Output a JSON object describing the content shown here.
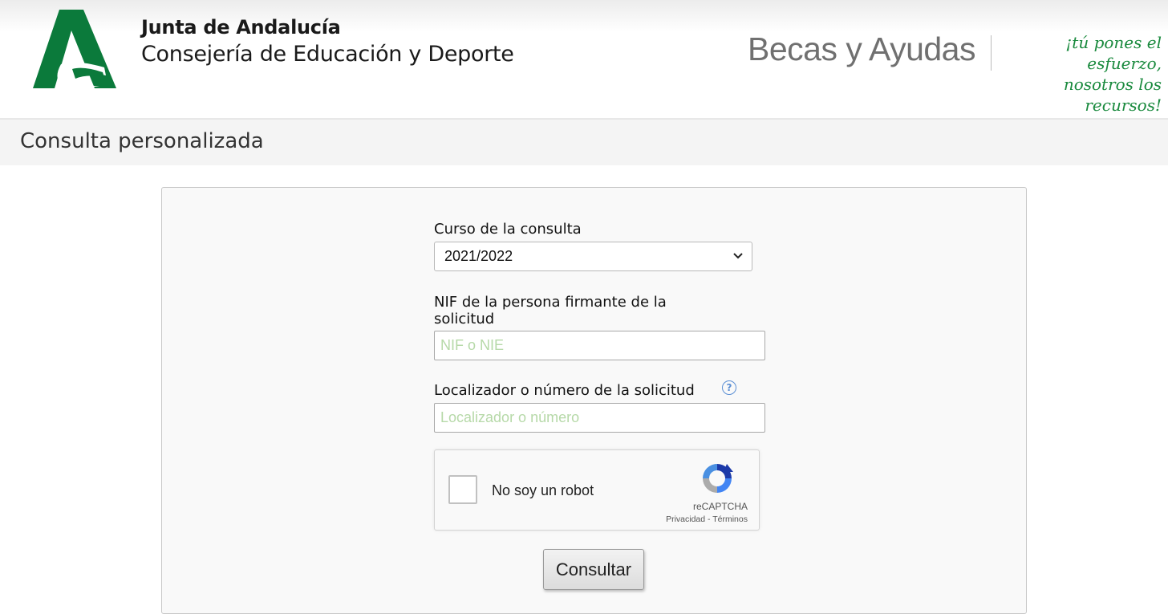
{
  "header": {
    "org_name": "Junta de Andalucía",
    "dept_name": "Consejería de Educación y Deporte",
    "program_title": "Becas y Ayudas",
    "slogan_line1": "¡tú pones el esfuerzo,",
    "slogan_line2": "nosotros los recursos!",
    "brand_color": "#0b7a3b"
  },
  "page": {
    "title": "Consulta personalizada"
  },
  "form": {
    "course_label": "Curso de la consulta",
    "course_selected": "2021/2022",
    "nif_label_line1": "NIF de la persona firmante de la",
    "nif_label_line2": "solicitud",
    "nif_placeholder": "NIF o NIE",
    "locator_label": "Localizador o número de la solicitud",
    "locator_help": "?",
    "locator_placeholder": "Localizador o número",
    "submit_label": "Consultar"
  },
  "captcha": {
    "text": "No soy un robot",
    "brand": "reCAPTCHA",
    "links": "Privacidad - Términos"
  }
}
